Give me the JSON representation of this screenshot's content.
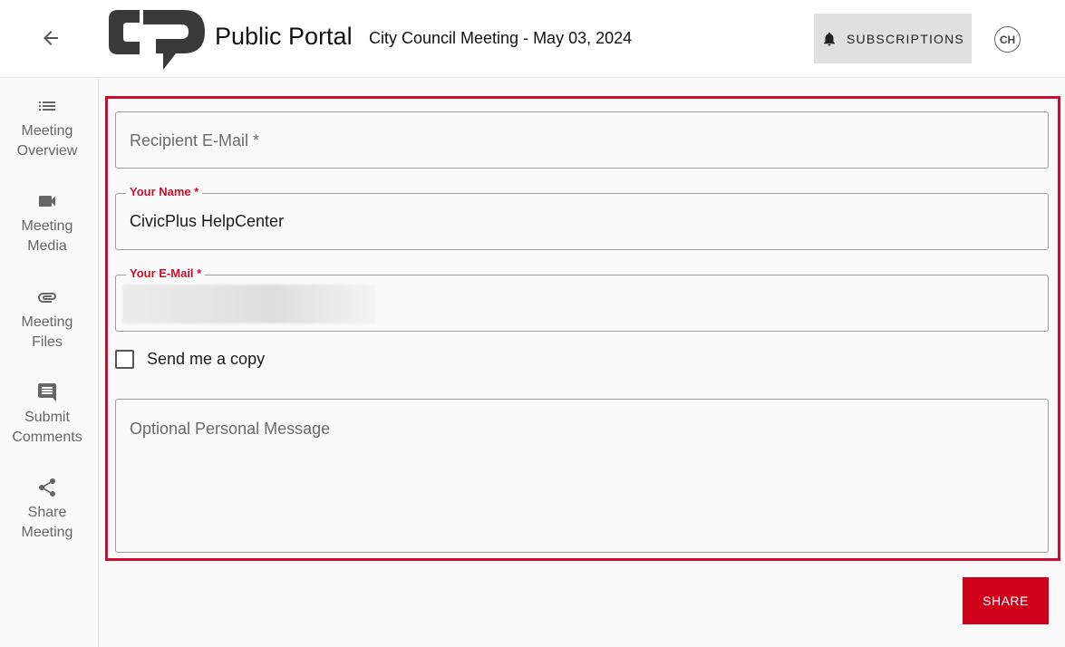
{
  "header": {
    "portal_title": "Public Portal",
    "meeting_title": "City Council Meeting - May 03, 2024",
    "subscriptions_label": "SUBSCRIPTIONS",
    "avatar_initials": "CH",
    "back_icon": "arrow-left-icon",
    "bell_icon": "bell-icon"
  },
  "sidebar": {
    "items": [
      {
        "label_line1": "Meeting",
        "label_line2": "Overview",
        "icon": "list-icon"
      },
      {
        "label_line1": "Meeting",
        "label_line2": "Media",
        "icon": "video-camera-icon"
      },
      {
        "label_line1": "Meeting",
        "label_line2": "Files",
        "icon": "paperclip-icon"
      },
      {
        "label_line1": "Submit",
        "label_line2": "Comments",
        "icon": "comment-icon"
      },
      {
        "label_line1": "Share",
        "label_line2": "Meeting",
        "icon": "share-icon"
      }
    ]
  },
  "form": {
    "recipient_email": {
      "placeholder": "Recipient E-Mail *",
      "value": ""
    },
    "your_name": {
      "label": "Your Name *",
      "value": "CivicPlus HelpCenter"
    },
    "your_email": {
      "label": "Your E-Mail *",
      "value": ""
    },
    "send_copy": {
      "label": "Send me a copy",
      "checked": false
    },
    "message": {
      "placeholder": "Optional Personal Message",
      "value": ""
    },
    "share_label": "SHARE"
  },
  "colors": {
    "accent": "#d0021b",
    "highlight_border": "#c8102e",
    "logo": "#3a3a3a"
  }
}
